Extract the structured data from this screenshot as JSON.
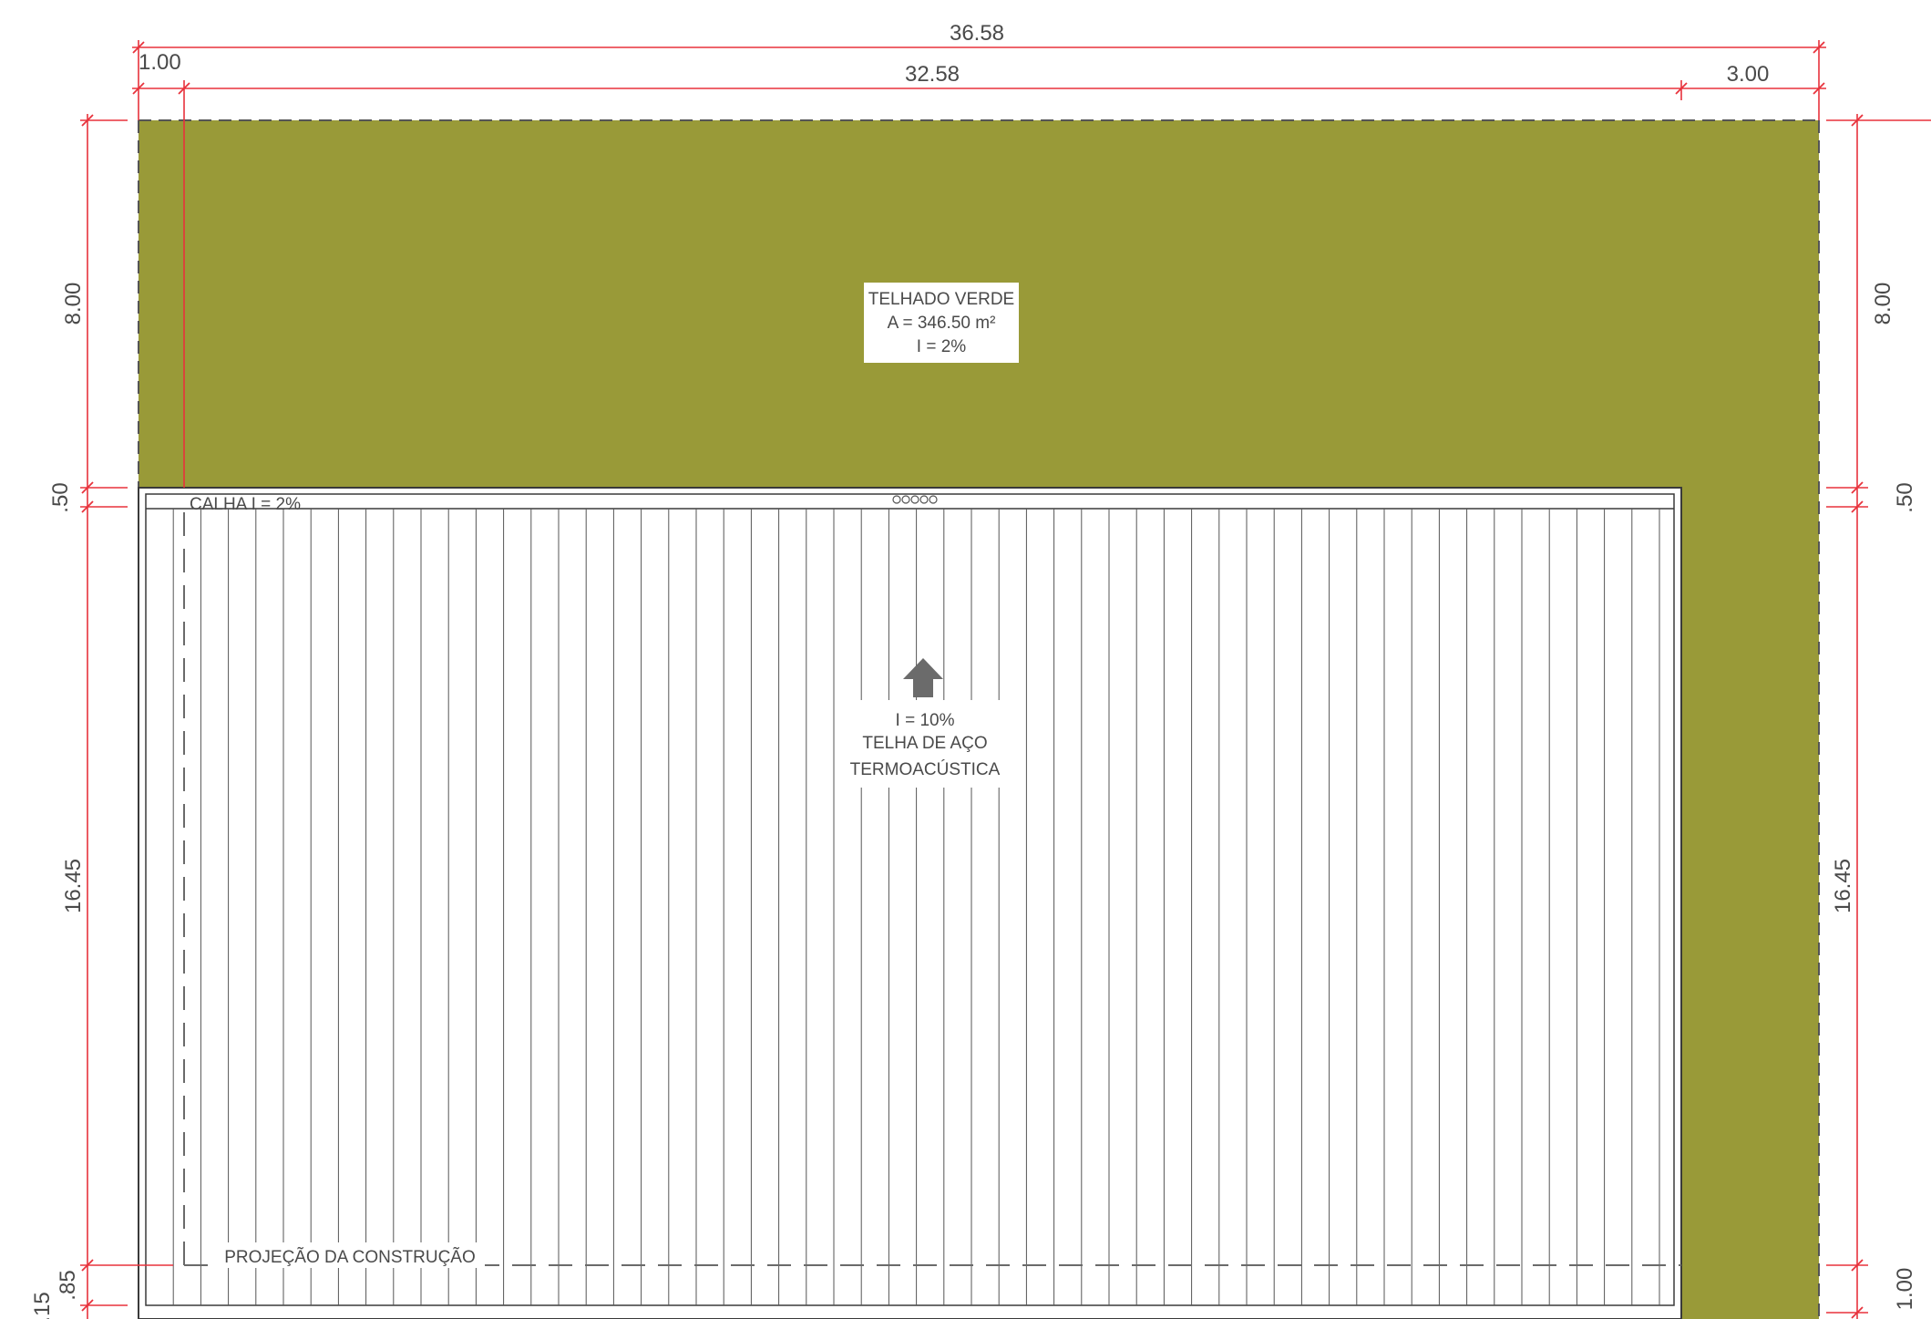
{
  "colors": {
    "green_roof": "#999a38",
    "dimension": "#e8323c",
    "outline": "#3a3a3a",
    "rib": "#555555",
    "dashed": "#6a6a6a",
    "text": "#4a4a4a",
    "arrow": "#6b6b6b",
    "label_bg": "#ffffff"
  },
  "dimensions": {
    "top_total": "36.58",
    "top_left": "1.00",
    "top_mid": "32.58",
    "top_right": "3.00",
    "left_8": "8.00",
    "left_050": ".50",
    "left_1645": "16.45",
    "left_085": ".85",
    "left_015": ".15",
    "right_8": "8.00",
    "right_050": ".50",
    "right_1645": "16.45",
    "right_100": "1.00"
  },
  "labels": {
    "green_roof_line1": "TELHADO VERDE",
    "green_roof_line2": "A = 346.50 m²",
    "green_roof_line3": "I = 2%",
    "gutter": "CALHA I = 2%",
    "slope": "I = 10%",
    "roof_type_line1": "TELHA DE AÇO",
    "roof_type_line2": "TERMOACÚSTICA",
    "projection": "PROJEÇÃO DA CONSTRUÇÃO"
  },
  "icons": {
    "flow_arrow": "arrow-up-icon",
    "drains": "drain-circles-icon"
  }
}
